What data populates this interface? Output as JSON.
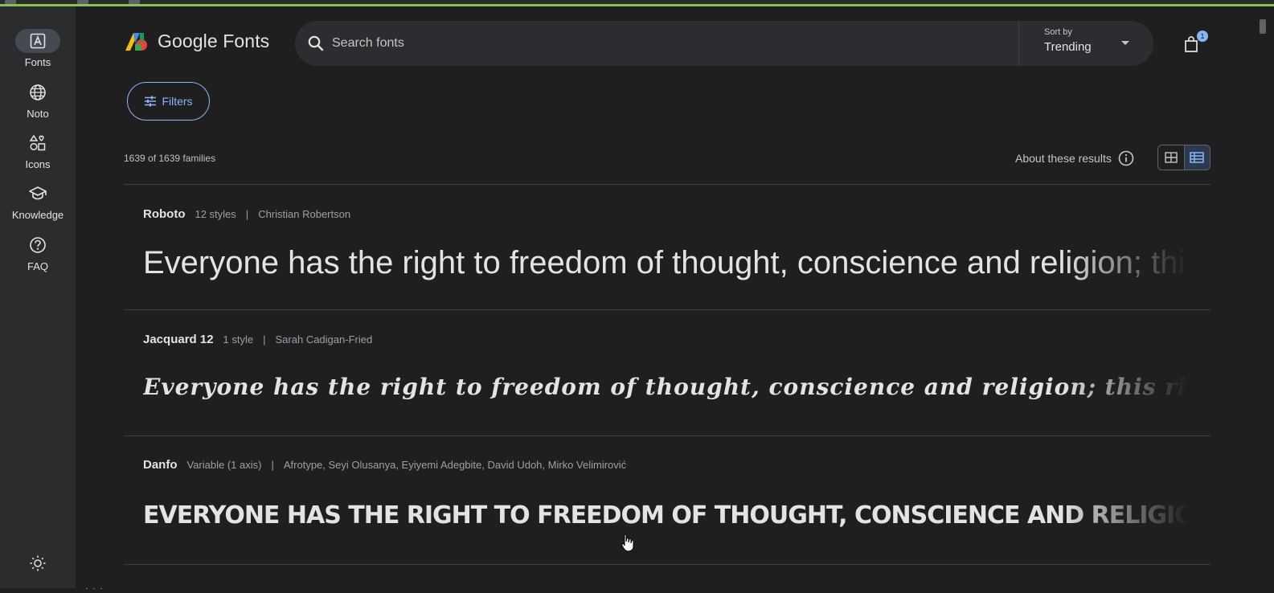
{
  "rail": {
    "items": [
      {
        "label": "Fonts",
        "icon": "font-a-icon",
        "active": true
      },
      {
        "label": "Noto",
        "icon": "globe-icon"
      },
      {
        "label": "Icons",
        "icon": "shapes-icon"
      },
      {
        "label": "Knowledge",
        "icon": "graduation-cap-icon"
      },
      {
        "label": "FAQ",
        "icon": "help-icon"
      }
    ]
  },
  "header": {
    "logo_text": "Google Fonts",
    "search_placeholder": "Search fonts",
    "sort_label": "Sort by",
    "sort_value": "Trending",
    "cart_count": "1"
  },
  "toolbar": {
    "filters_label": "Filters",
    "result_count": "1639 of 1639 families",
    "about_label": "About these results"
  },
  "fonts": [
    {
      "name": "Roboto",
      "styles": "12 styles",
      "designer": "Christian Robertson",
      "preview": "Everyone has the right to freedom of thought, conscience and religion; this right includes freedom to change his religion or belief"
    },
    {
      "name": "Jacquard 12",
      "styles": "1 style",
      "designer": "Sarah Cadigan-Fried",
      "preview": "Everyone has the right to freedom of thought, conscience and religion; this right includes freedom to change"
    },
    {
      "name": "Danfo",
      "styles": "Variable (1 axis)",
      "designer": "Afrotype, Seyi Olusanya, Eyiyemi Adegbite, David Udoh, Mirko Velimirović",
      "preview": "EVERYONE HAS THE RIGHT TO FREEDOM OF THOUGHT, CONSCIENCE AND RELIGION"
    }
  ]
}
